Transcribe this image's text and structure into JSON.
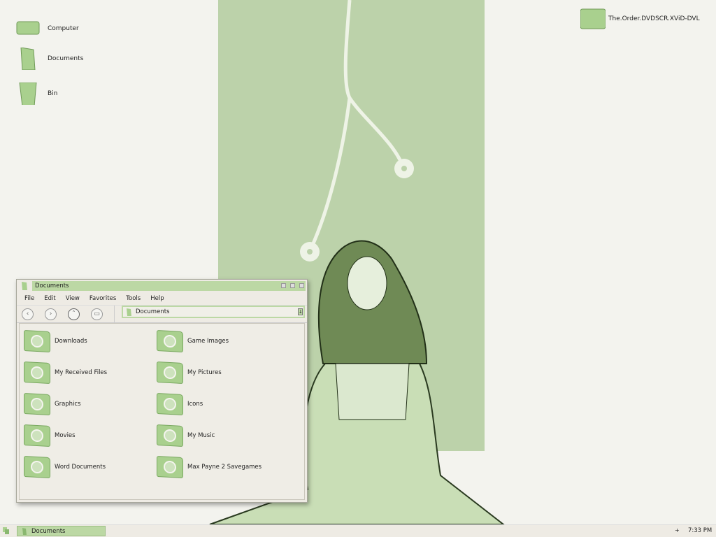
{
  "desktop": {
    "icons": [
      {
        "label": "Computer"
      },
      {
        "label": "Documents"
      },
      {
        "label": "Bin"
      }
    ],
    "file": "The.Order.DVDSCR.XViD-DVL"
  },
  "window": {
    "title": "Documents",
    "menu": [
      "File",
      "Edit",
      "View",
      "Favorites",
      "Tools",
      "Help"
    ],
    "address": "Documents",
    "items": [
      "Downloads",
      "Game Images",
      "My Received Files",
      "My Pictures",
      "Graphics",
      "Icons",
      "Movies",
      "My Music",
      "Word Documents",
      "Max Payne 2 Savegames"
    ]
  },
  "taskbar": {
    "task": "Documents",
    "clock": "7:33 PM"
  },
  "colors": {
    "accent": "#bcd8a4",
    "wallpaper": "#bcd2aa"
  }
}
